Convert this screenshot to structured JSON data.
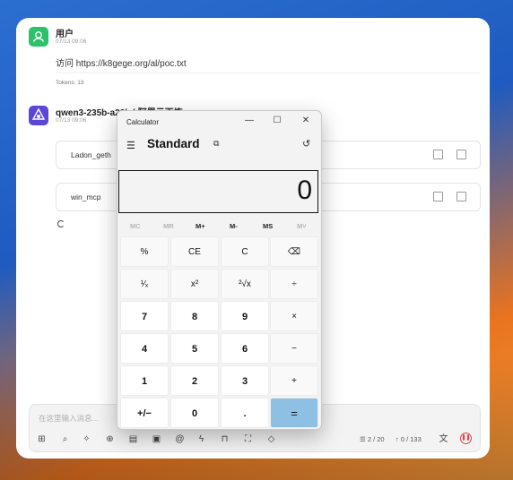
{
  "chat": {
    "user": {
      "name": "用户",
      "time": "07/13 09:06",
      "message": "访问 https://k8gege.org/al/poc.txt"
    },
    "tokens": "Tokens: 13",
    "assistant": {
      "name": "qwen3-235b-a22b | 阿里云百炼",
      "time": "07/13 09:06"
    },
    "tools": [
      {
        "label": "Ladon_geth"
      },
      {
        "label": "win_mcp"
      }
    ],
    "composer": {
      "placeholder": "在这里输入消息...",
      "page": "2 / 20",
      "tokens": "0 / 133"
    }
  },
  "calculator": {
    "title": "Calculator",
    "mode": "Standard",
    "display": "0",
    "memory": [
      {
        "label": "MC",
        "enabled": false
      },
      {
        "label": "MR",
        "enabled": false
      },
      {
        "label": "M+",
        "enabled": true
      },
      {
        "label": "M-",
        "enabled": true
      },
      {
        "label": "MS",
        "enabled": true
      },
      {
        "label": "M˅",
        "enabled": false
      }
    ],
    "keys": [
      [
        "%",
        "CE",
        "C",
        "⌫"
      ],
      [
        "¹⁄ₓ",
        "x²",
        "²√x",
        "÷"
      ],
      [
        "7",
        "8",
        "9",
        "×"
      ],
      [
        "4",
        "5",
        "6",
        "−"
      ],
      [
        "1",
        "2",
        "3",
        "+"
      ],
      [
        "+/−",
        "0",
        ".",
        "="
      ]
    ]
  }
}
